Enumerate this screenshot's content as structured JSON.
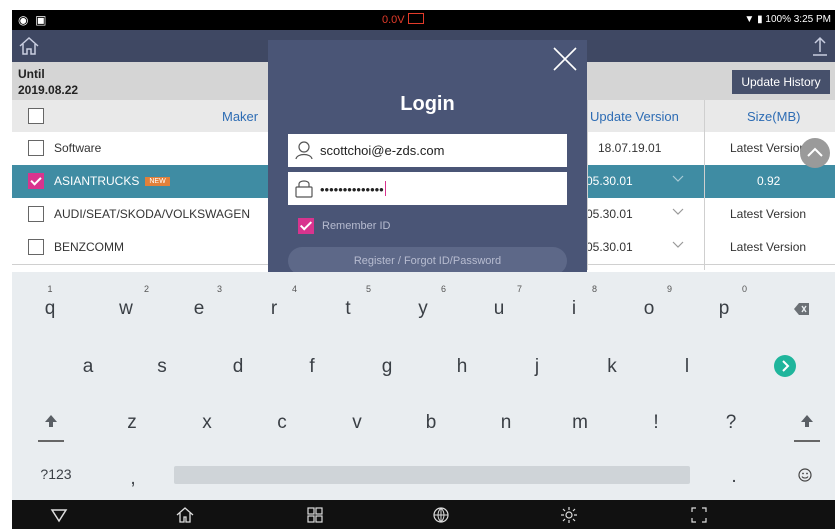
{
  "status_bar": {
    "voltage": "0.0V",
    "battery": "100%",
    "time": "3:25 PM"
  },
  "app_bar": {
    "home_icon": "home-icon",
    "upload_icon": "upload-icon"
  },
  "header": {
    "until_label": "Until",
    "until_date": "2019.08.22",
    "update_history_label": "Update History"
  },
  "table": {
    "columns": {
      "maker": "Maker",
      "update_version": "Update Version",
      "size": "Size(MB)"
    },
    "rows": [
      {
        "name": "Software",
        "version": "18.07.19.01",
        "size": "Latest Version",
        "checked": false,
        "badge": ""
      },
      {
        "name": "ASIANTRUCKS",
        "version": "05.30.01",
        "size": "0.92",
        "checked": true,
        "badge": "NEW"
      },
      {
        "name": "AUDI/SEAT/SKODA/VOLKSWAGEN",
        "version": "05.30.01",
        "size": "Latest Version",
        "checked": false,
        "badge": ""
      },
      {
        "name": "BENZCOMM",
        "version": "05.30.01",
        "size": "Latest Version",
        "checked": false,
        "badge": ""
      }
    ]
  },
  "login": {
    "title": "Login",
    "user_id": "scottchoi@e-zds.com",
    "password_mask": "••••••••••••••",
    "remember_label": "Remember ID",
    "register_label": "Register / Forgot ID/Password"
  },
  "keyboard": {
    "row1": [
      {
        "k": "q",
        "h": "1"
      },
      {
        "k": "w",
        "h": "2"
      },
      {
        "k": "e",
        "h": "3"
      },
      {
        "k": "r",
        "h": "4"
      },
      {
        "k": "t",
        "h": "5"
      },
      {
        "k": "y",
        "h": "6"
      },
      {
        "k": "u",
        "h": "7"
      },
      {
        "k": "i",
        "h": "8"
      },
      {
        "k": "o",
        "h": "9"
      },
      {
        "k": "p",
        "h": "0"
      }
    ],
    "row2": [
      "a",
      "s",
      "d",
      "f",
      "g",
      "h",
      "j",
      "k",
      "l"
    ],
    "row3": [
      "z",
      "x",
      "c",
      "v",
      "b",
      "n",
      "m",
      "!",
      "?"
    ],
    "symbols_key": "?123",
    "comma": ",",
    "period": ".",
    "backspace_icon": "backspace-icon",
    "go_icon": "go-icon",
    "shift_icon": "shift-icon",
    "emoji_icon": "emoji-icon"
  },
  "colors": {
    "accent": "#d8348e",
    "dialog": "#4a5576",
    "appbar": "#3f4863",
    "selected_row": "#3f8ca3",
    "go": "#1fb59c"
  }
}
